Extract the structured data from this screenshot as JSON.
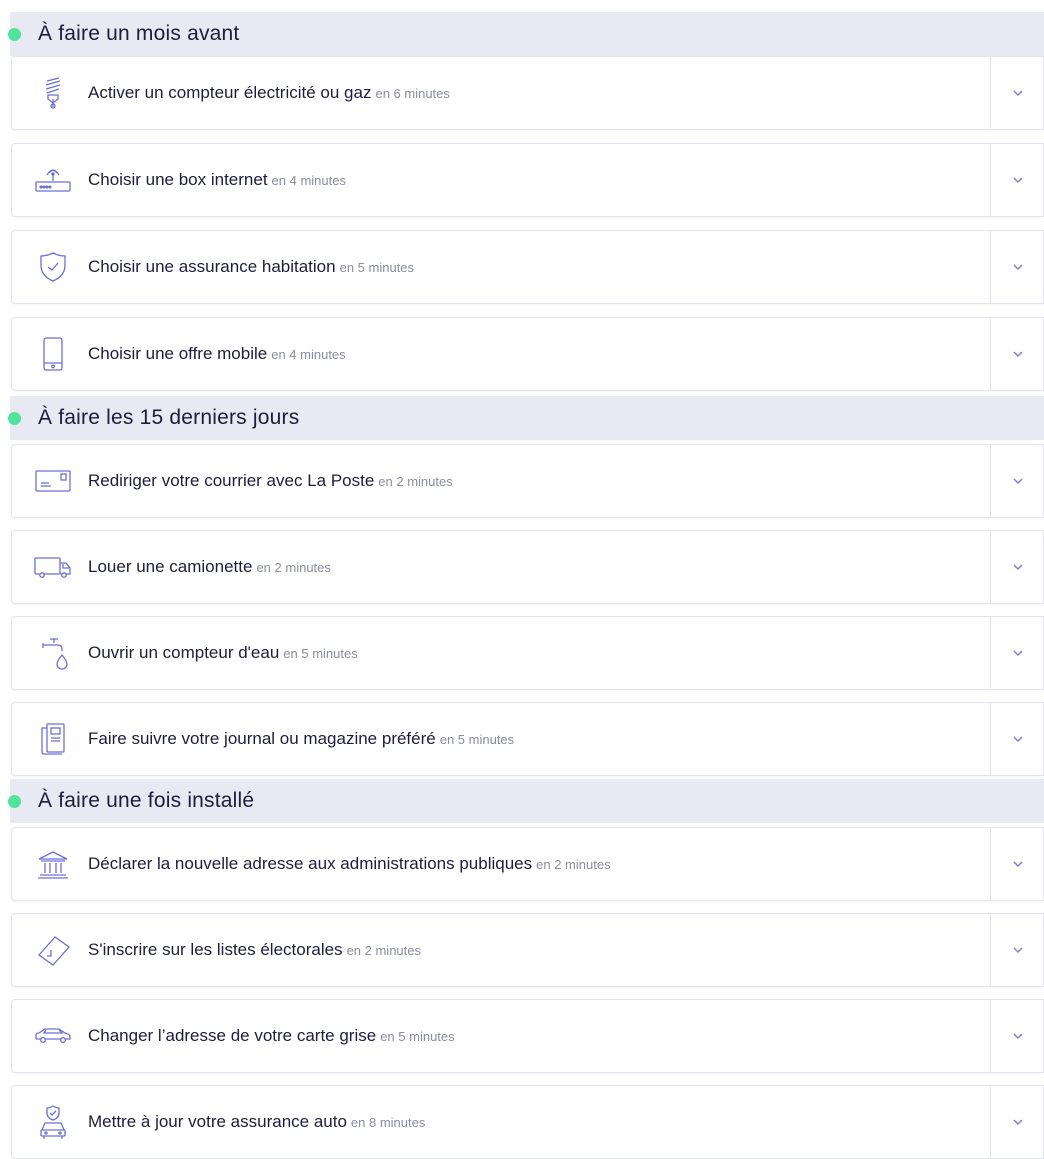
{
  "colors": {
    "accent_dot": "#4fe39d",
    "icon_stroke": "#6b6fd6",
    "header_bg": "#e8eaf3",
    "chevron": "#7b7fd8"
  },
  "sections": [
    {
      "title": "À faire un mois avant",
      "items": [
        {
          "label": "Activer un compteur électricité ou gaz",
          "duration": "en 6 minutes",
          "icon": "plug-bolt-icon"
        },
        {
          "label": "Choisir une box internet",
          "duration": "en 4 minutes",
          "icon": "router-icon"
        },
        {
          "label": "Choisir une assurance habitation",
          "duration": "en 5 minutes",
          "icon": "shield-icon"
        },
        {
          "label": "Choisir une offre mobile",
          "duration": "en 4 minutes",
          "icon": "smartphone-icon"
        }
      ]
    },
    {
      "title": "À faire les 15 derniers jours",
      "items": [
        {
          "label": "Rediriger votre courrier avec La Poste",
          "duration": "en 2 minutes",
          "icon": "envelope-icon"
        },
        {
          "label": "Louer une camionette",
          "duration": "en 2 minutes",
          "icon": "truck-icon"
        },
        {
          "label": "Ouvrir un compteur d'eau",
          "duration": "en 5 minutes",
          "icon": "faucet-icon"
        },
        {
          "label": "Faire suivre votre journal ou magazine préféré",
          "duration": "en 5 minutes",
          "icon": "newspaper-icon"
        }
      ]
    },
    {
      "title": "À faire une fois installé",
      "items": [
        {
          "label": "Déclarer la nouvelle adresse aux administrations publiques",
          "duration": "en 2 minutes",
          "icon": "government-building-icon"
        },
        {
          "label": "S'inscrire sur les listes électorales",
          "duration": "en 2 minutes",
          "icon": "ballot-icon"
        },
        {
          "label": "Changer l’adresse de votre carte grise",
          "duration": "en 5 minutes",
          "icon": "car-icon"
        },
        {
          "label": "Mettre à jour votre assurance auto",
          "duration": "en 8 minutes",
          "icon": "car-insurance-icon"
        }
      ]
    }
  ]
}
